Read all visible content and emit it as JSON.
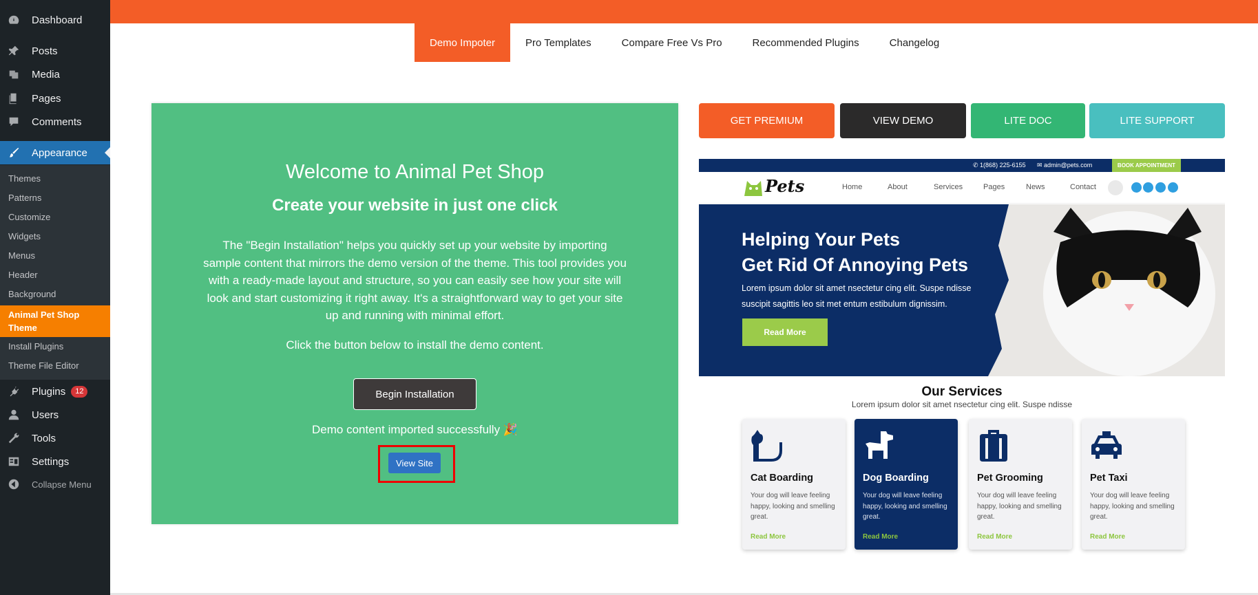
{
  "sidebar": {
    "items": [
      {
        "label": "Dashboard",
        "icon": "dashboard-icon"
      },
      {
        "label": "Posts",
        "icon": "pin-icon"
      },
      {
        "label": "Media",
        "icon": "media-icon"
      },
      {
        "label": "Pages",
        "icon": "pages-icon"
      },
      {
        "label": "Comments",
        "icon": "comment-icon"
      },
      {
        "label": "Appearance",
        "icon": "brush-icon"
      },
      {
        "label": "Plugins",
        "icon": "plugin-icon",
        "badge": "12"
      },
      {
        "label": "Users",
        "icon": "user-icon"
      },
      {
        "label": "Tools",
        "icon": "wrench-icon"
      },
      {
        "label": "Settings",
        "icon": "settings-icon"
      }
    ],
    "subitems": [
      "Themes",
      "Patterns",
      "Customize",
      "Widgets",
      "Menus",
      "Header",
      "Background",
      "Animal Pet Shop Theme",
      "Install Plugins",
      "Theme File Editor"
    ],
    "collapse_label": "Collapse Menu"
  },
  "tabs": [
    "Demo Impoter",
    "Pro Templates",
    "Compare Free Vs Pro",
    "Recommended Plugins",
    "Changelog"
  ],
  "panel": {
    "welcome": "Welcome to Animal Pet Shop",
    "headline": "Create your website in just one click",
    "description": "The \"Begin Installation\" helps you quickly set up your website by importing sample content that mirrors the demo version of the theme. This tool provides you with a ready-made layout and structure, so you can easily see how your site will look and start customizing it right away. It's a straightforward way to get your site up and running with minimal effort.",
    "note": "Click the button below to install the demo content.",
    "begin_label": "Begin Installation",
    "success": "Demo content imported successfully 🎉",
    "view_label": "View Site"
  },
  "actions": {
    "premium": "GET PREMIUM",
    "demo": "VIEW DEMO",
    "doc": "LITE DOC",
    "support": "LITE SUPPORT"
  },
  "preview": {
    "phone": "1(868) 225-6155",
    "email": "admin@pets.com",
    "book": "BOOK APPOINTMENT",
    "logo": "Pets",
    "nav": [
      "Home",
      "About",
      "Services",
      "Pages",
      "News",
      "Contact"
    ],
    "hero_line1": "Helping Your Pets",
    "hero_line2": "Get Rid Of Annoying Pets",
    "hero_text": "Lorem ipsum dolor sit amet nsectetur cing elit. Suspe ndisse suscipit sagittis leo sit met entum estibulum dignissim.",
    "hero_button": "Read More",
    "services_title": "Our Services",
    "services_sub": "Lorem ipsum dolor sit amet nsectetur cing elit. Suspe ndisse",
    "cards": [
      {
        "title": "Cat Boarding",
        "text": "Your dog will leave feeling happy, looking and smelling great.",
        "link": "Read More"
      },
      {
        "title": "Dog Boarding",
        "text": "Your dog will leave feeling happy, looking and smelling great.",
        "link": "Read More"
      },
      {
        "title": "Pet Grooming",
        "text": "Your dog will leave feeling happy, looking and smelling great.",
        "link": "Read More"
      },
      {
        "title": "Pet Taxi",
        "text": "Your dog will leave feeling happy, looking and smelling great.",
        "link": "Read More"
      }
    ]
  },
  "colors": {
    "accent": "#f35d27",
    "panel_green": "#51bf82",
    "wp_blue": "#2271b1",
    "theme_orange": "#f67f00",
    "navy": "#0c2d66",
    "lime": "#9bcb4a"
  }
}
